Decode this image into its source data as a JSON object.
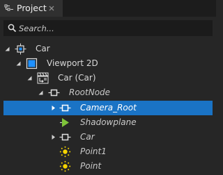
{
  "panel": {
    "title": "Project",
    "icon": "project-panel-icon",
    "close_icon": "close-icon"
  },
  "search": {
    "placeholder": "Search...",
    "value": "",
    "icon": "search-icon"
  },
  "tree": {
    "nodes": [
      {
        "label": "Car",
        "icon": "3d-node-icon",
        "expanded": true,
        "italic": false
      },
      {
        "label": "Viewport 2D",
        "icon": "viewport-icon",
        "expanded": true,
        "italic": false
      },
      {
        "label": "Car (Car)",
        "icon": "scene-icon",
        "expanded": true,
        "italic": false
      },
      {
        "label": "RootNode",
        "icon": "node-icon",
        "expanded": true,
        "italic": true
      },
      {
        "label": "Camera_Root",
        "icon": "node-icon",
        "expanded": false,
        "italic": true,
        "selected": true
      },
      {
        "label": "Shadowplane",
        "icon": "plane-icon",
        "expanded": null,
        "italic": true
      },
      {
        "label": "Car",
        "icon": "node-icon",
        "expanded": false,
        "italic": true
      },
      {
        "label": "Point1",
        "icon": "point-light-icon",
        "expanded": null,
        "italic": true
      },
      {
        "label": "Point",
        "icon": "point-light-icon",
        "expanded": null,
        "italic": true
      }
    ]
  },
  "colors": {
    "selection": "#1a73c5",
    "background": "#262626",
    "tab_background": "#303030",
    "light_icon": "#f5d400",
    "plane_icon": "#7ec43a",
    "viewport_icon": "#1e90ff"
  }
}
